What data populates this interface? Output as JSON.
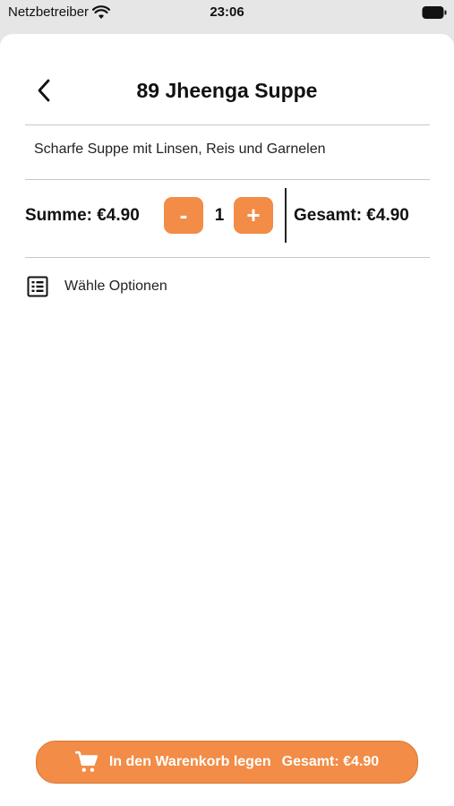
{
  "status_bar": {
    "carrier": "Netzbetreiber",
    "time": "23:06"
  },
  "header": {
    "title": "89 Jheenga Suppe"
  },
  "item": {
    "description": "Scharfe Suppe mit Linsen, Reis und Garnelen",
    "sum_label": "Summe: €4.90",
    "quantity": "1",
    "minus_label": "-",
    "plus_label": "+",
    "total_label": "Gesamt: €4.90"
  },
  "options": {
    "label": "Wähle Optionen"
  },
  "cart_button": {
    "label": "In den Warenkorb legen",
    "total": "Gesamt: €4.90"
  },
  "colors": {
    "accent": "#f28c47"
  }
}
